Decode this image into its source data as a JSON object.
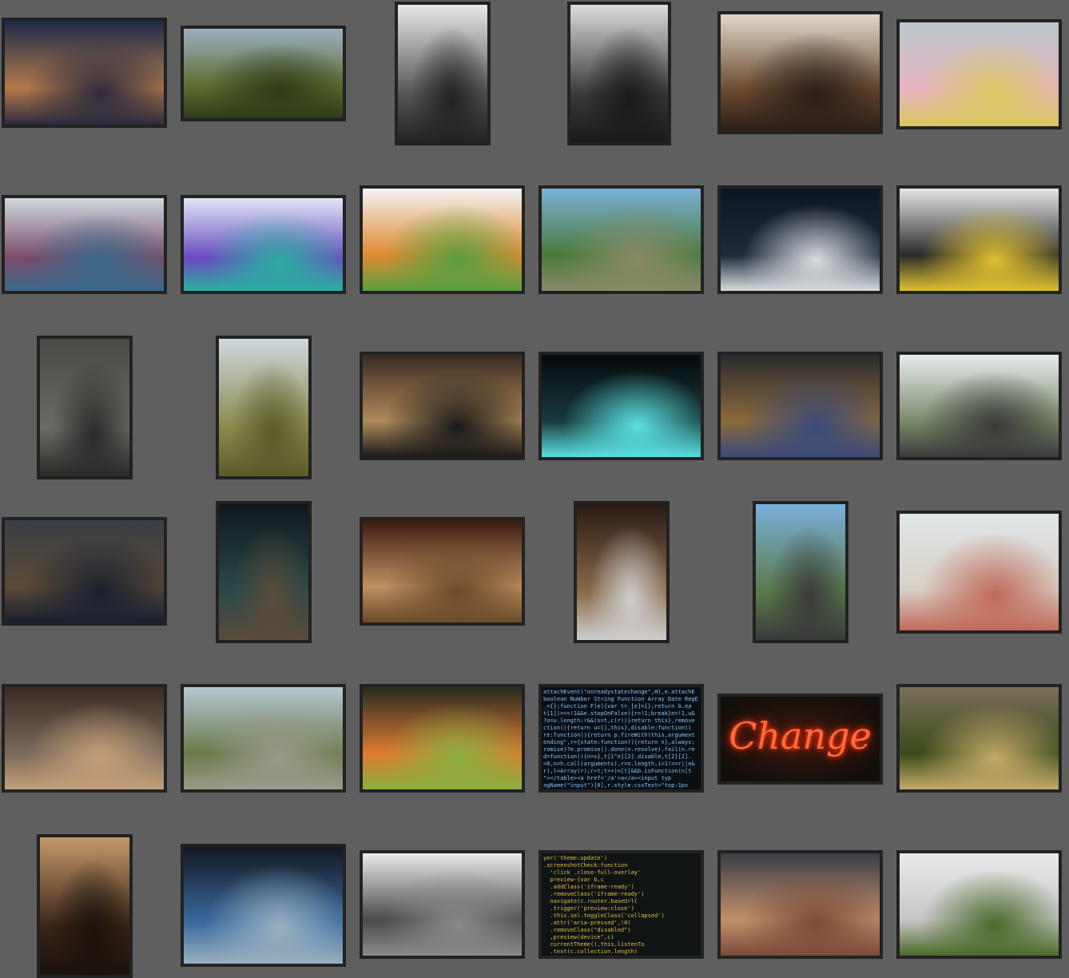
{
  "gallery": {
    "background": "#5f5f5f",
    "rows": [
      [
        {
          "subject": "person silhouette under dramatic sky",
          "colors": [
            "#1d2a4a",
            "#b27a4a",
            "#2c2a3e"
          ],
          "aspect": "landscape"
        },
        {
          "subject": "green coastal hills",
          "colors": [
            "#9bb0c4",
            "#5e6b2e",
            "#2f3a1a"
          ],
          "aspect": "landscape"
        },
        {
          "subject": "black and white architecture",
          "colors": [
            "#e8e8e8",
            "#555555",
            "#222222"
          ],
          "aspect": "portrait"
        },
        {
          "subject": "skyscrapers looking up",
          "colors": [
            "#dcdcdc",
            "#3a3a3a",
            "#1a1a1a"
          ],
          "aspect": "portrait"
        },
        {
          "subject": "stacks of books",
          "colors": [
            "#e0d8cc",
            "#6b4a30",
            "#2a1e18"
          ],
          "aspect": "landscape"
        },
        {
          "subject": "sticky notes on wall",
          "colors": [
            "#b9c6cc",
            "#e7b2be",
            "#d9c860"
          ],
          "aspect": "landscape"
        }
      ],
      [
        {
          "subject": "origami on table",
          "colors": [
            "#cfd8dc",
            "#7a4a6a",
            "#3a6a8a"
          ],
          "aspect": "landscape"
        },
        {
          "subject": "paper cranes",
          "colors": [
            "#dfe6f6",
            "#6a4ac0",
            "#2ab0a0"
          ],
          "aspect": "landscape"
        },
        {
          "subject": "row of potted flowers",
          "colors": [
            "#f2f2f2",
            "#e08a30",
            "#5aa040"
          ],
          "aspect": "landscape"
        },
        {
          "subject": "rocky green coastline",
          "colors": [
            "#7ab0d8",
            "#4a7a3a",
            "#8a8a6a"
          ],
          "aspect": "landscape"
        },
        {
          "subject": "person coding on laptop",
          "colors": [
            "#0d1522",
            "#1e2a3a",
            "#d8dcdf"
          ],
          "aspect": "landscape"
        },
        {
          "subject": "laptop with code and plant",
          "colors": [
            "#e6e6e6",
            "#2a2a2a",
            "#e0c030"
          ],
          "aspect": "landscape"
        }
      ],
      [
        {
          "subject": "sticker-covered laptop",
          "colors": [
            "#4a4a44",
            "#6a6a66",
            "#2a2a28"
          ],
          "aspect": "portrait"
        },
        {
          "subject": "bicycle in valley",
          "colors": [
            "#cfd8df",
            "#8a8a4a",
            "#5a5a2a"
          ],
          "aspect": "portrait"
        },
        {
          "subject": "open office desks",
          "colors": [
            "#3a2a22",
            "#b08a5a",
            "#1a1a1a"
          ],
          "aspect": "landscape"
        },
        {
          "subject": "glowing keyboard keys",
          "colors": [
            "#050a0c",
            "#1a3a3e",
            "#5ae0e0"
          ],
          "aspect": "landscape"
        },
        {
          "subject": "person typing on laptop",
          "colors": [
            "#2a2a2e",
            "#8a6a3a",
            "#3a4a7a"
          ],
          "aspect": "landscape"
        },
        {
          "subject": "laptop by window",
          "colors": [
            "#e8ecef",
            "#7a8a6a",
            "#3a3a3a"
          ],
          "aspect": "landscape"
        }
      ],
      [
        {
          "subject": "mountain lake under clouds",
          "colors": [
            "#3a3e46",
            "#5a4a36",
            "#1a2030"
          ],
          "aspect": "landscape"
        },
        {
          "subject": "developer at night desk",
          "colors": [
            "#10181e",
            "#2a4a4a",
            "#5a4a3a"
          ],
          "aspect": "portrait"
        },
        {
          "subject": "row of buddha statues",
          "colors": [
            "#3a1a10",
            "#c09060",
            "#6a4a2a"
          ],
          "aspect": "landscape"
        },
        {
          "subject": "compass before waterfall",
          "colors": [
            "#2a1a14",
            "#8a6a4a",
            "#cfcfcf"
          ],
          "aspect": "portrait"
        },
        {
          "subject": "harbor with boats",
          "colors": [
            "#7ab0dc",
            "#5a7a4a",
            "#3a3a3a"
          ],
          "aspect": "portrait"
        },
        {
          "subject": "pig on beach",
          "colors": [
            "#e0e6e8",
            "#d8d0c6",
            "#c06a5a"
          ],
          "aspect": "landscape"
        }
      ],
      [
        {
          "subject": "cat on wooden chair",
          "colors": [
            "#3a2a22",
            "#7a6a5a",
            "#c4a07a"
          ],
          "aspect": "landscape"
        },
        {
          "subject": "boardwalk to sea",
          "colors": [
            "#b6c8d2",
            "#6a7a4a",
            "#9a9a8a"
          ],
          "aspect": "landscape"
        },
        {
          "subject": "vegetables in bowls",
          "colors": [
            "#2a2a22",
            "#e07a30",
            "#8ab040"
          ],
          "aspect": "landscape"
        },
        {
          "subject": "javascript source code",
          "colors": [
            "#0a0f14",
            "#6ad0ff",
            "#ff8a5a"
          ],
          "aspect": "landscape"
        },
        {
          "subject": "neon Change sign",
          "colors": [
            "#1a1410",
            "#ff5a2a",
            "#3a2a22"
          ],
          "aspect": "landscape"
        },
        {
          "subject": "grassy hill at sunset",
          "colors": [
            "#7a6e5a",
            "#3a4a1a",
            "#c4aa6a"
          ],
          "aspect": "landscape"
        }
      ],
      [
        {
          "subject": "guitar neck close-up",
          "colors": [
            "#c49a6a",
            "#3a2418",
            "#1a120c"
          ],
          "aspect": "portrait"
        },
        {
          "subject": "glasses before code monitors",
          "colors": [
            "#121820",
            "#3a6aa0",
            "#9ab0c0"
          ],
          "aspect": "landscape"
        },
        {
          "subject": "imac in bright office",
          "colors": [
            "#eaeaea",
            "#4a4a4a",
            "#8a8a8a"
          ],
          "aspect": "landscape"
        },
        {
          "subject": "colorful code screen",
          "colors": [
            "#101414",
            "#e0c040",
            "#6ab0e0"
          ],
          "aspect": "landscape"
        },
        {
          "subject": "woman with eyes closed",
          "colors": [
            "#3a3e46",
            "#c4906a",
            "#7a4a3a"
          ],
          "aspect": "landscape"
        },
        {
          "subject": "sprout in sand",
          "colors": [
            "#eaeaea",
            "#c6c6c6",
            "#4a6a2a"
          ],
          "aspect": "landscape"
        }
      ]
    ],
    "code_text": "attachEvent(\"onreadystatechange\",H),e.attachE\nboolean Number String Function Array Date RegE\n_={};function F(e){var t=_[e]={};return b.ea\nt[1])===!1&&e.stopOnFalse){r=!1;break}n=!1,u&\n?o=u.length:r&&(s=t,c(r))}return this},remove\nction(){return u=[],this},disable:function()\nre:function(){return p.fireWith(this,argument\nending\",r={state:function(){return n},always:\nromise)?e.promise().done(n.resolve).fail(n.re\nd=function(){n=s},t[1^e][2].disable,t[2][2].\n=0,n=h.call(arguments),r=n.length,i=1!==r||e&\nr),l=Array(r);r>t;t++)n[t]&&b.isFunction(n[t\n\"></table><a href='/a'>a</a><input typ\nagName(\"input\")[0],r.style.cssText=\"top:1px\ntest(r.getAttribute(\"style\")),hrefNormalized:",
    "code_text_2": "yer('theme:update')\n.screenshotCheck:function\n  'click .close-full-overlay'\n  preview-{var b,c\n  .addClass('iframe-ready')\n  .removeClass('iframe-ready')\n  navigate(c.router.baseUrl(\n  .trigger('preview:close')\n  .this.sel.toggleClass('collapsed')\n  .attr('aria-pressed',!0)\n  .removeClass(\"disabled\")\n  ,preview(device\",c)\n  currentTheme(),this.listenTo\n  .text(c.collection.length)",
    "neon_text": "Change"
  }
}
